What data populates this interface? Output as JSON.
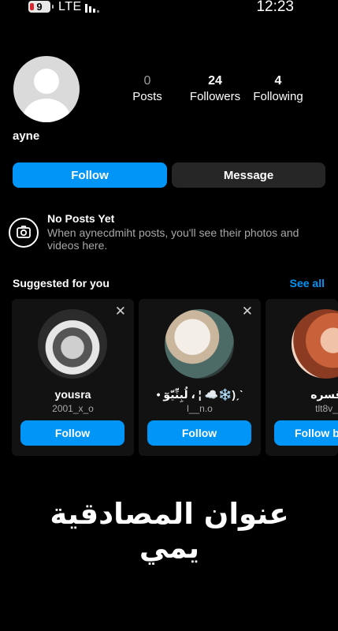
{
  "status_bar": {
    "battery": "9",
    "network": "LTE",
    "time": "12:23"
  },
  "profile": {
    "username": "ayne",
    "stats": [
      {
        "value": "0",
        "label": "Posts"
      },
      {
        "value": "24",
        "label": "Followers"
      },
      {
        "value": "4",
        "label": "Following"
      }
    ],
    "follow_label": "Follow",
    "message_label": "Message"
  },
  "no_posts": {
    "title": "No Posts Yet",
    "text": "When aynecdmiht posts, you'll see their photos and videos here."
  },
  "suggested": {
    "title": "Suggested for you",
    "see_all": "See all",
    "cards": [
      {
        "name": "yousra",
        "handle": "2001_x_o",
        "button": "Follow"
      },
      {
        "name": "• لُبِنِّيّوٓ ، ¦ ☁️❄️)ˏˋ",
        "handle": "l__n.o",
        "button": "Follow"
      },
      {
        "name": "قسره",
        "handle": "tlt8v_",
        "button": "Follow b"
      }
    ]
  },
  "overlay": {
    "text": "عنوان المصادقية يمي"
  },
  "colors": {
    "accent": "#0095f6",
    "background": "#000000",
    "secondary_button": "#262626"
  }
}
